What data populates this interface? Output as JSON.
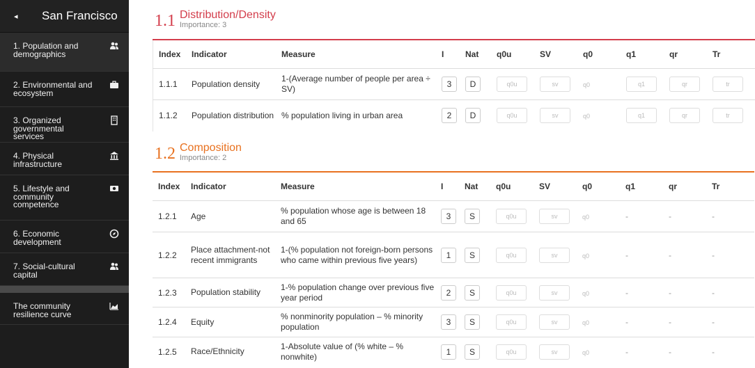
{
  "sidebar": {
    "back_icon": "◂",
    "title": "San Francisco",
    "items": [
      {
        "label": "1. Population and demographics",
        "icon": "users-icon",
        "active": true
      },
      {
        "label": "2. Environmental and ecosystem",
        "icon": "briefcase-icon"
      },
      {
        "label": "3. Organized governmental services",
        "icon": "building-icon"
      },
      {
        "label": "4. Physical infrastructure",
        "icon": "institution-icon"
      },
      {
        "label": "5. Lifestyle and community competence",
        "icon": "money-icon"
      },
      {
        "label": "6. Economic development",
        "icon": "compass-icon"
      },
      {
        "label": "7. Social-cultural capital",
        "icon": "users-icon"
      }
    ],
    "footer_item": {
      "label": "The community resilience curve",
      "icon": "area-chart-icon"
    }
  },
  "columns": [
    "Index",
    "Indicator",
    "Measure",
    "I",
    "Nat",
    "q0u",
    "SV",
    "q0",
    "q1",
    "qr",
    "Tr"
  ],
  "placeholders": {
    "q0u": "q0u",
    "sv": "sv",
    "q0": "q0",
    "q1": "q1",
    "qr": "qr",
    "tr": "tr"
  },
  "dash": "-",
  "sections": [
    {
      "num": "1.1",
      "title": "Distribution/Density",
      "importance": "Importance: 3",
      "color": "#d33d4b",
      "rows": [
        {
          "index": "1.1.1",
          "indicator": "Population density",
          "measure": "1-(Average number of people per area ÷ SV)",
          "i": "3",
          "nat": "D"
        },
        {
          "index": "1.1.2",
          "indicator": "Population distribution",
          "measure": "% population living in urban area",
          "i": "2",
          "nat": "D"
        }
      ]
    },
    {
      "num": "1.2",
      "title": "Composition",
      "importance": "Importance: 2",
      "color": "#e8711f",
      "rows": [
        {
          "index": "1.2.1",
          "indicator": "Age",
          "measure": "% population whose age is between 18 and 65",
          "i": "3",
          "nat": "S"
        },
        {
          "index": "1.2.2",
          "indicator": "Place attachment-not recent immigrants",
          "measure": "1-(% population not foreign-born persons who came within previous five years)",
          "i": "1",
          "nat": "S"
        },
        {
          "index": "1.2.3",
          "indicator": "Population stability",
          "measure": "1-% population change over previous five year period",
          "i": "2",
          "nat": "S"
        },
        {
          "index": "1.2.4",
          "indicator": "Equity",
          "measure": "% nonminority population – % minority population",
          "i": "3",
          "nat": "S"
        },
        {
          "index": "1.2.5",
          "indicator": "Race/Ethnicity",
          "measure": "1-Absolute value of (% white – % nonwhite)",
          "i": "1",
          "nat": "S"
        }
      ]
    }
  ]
}
